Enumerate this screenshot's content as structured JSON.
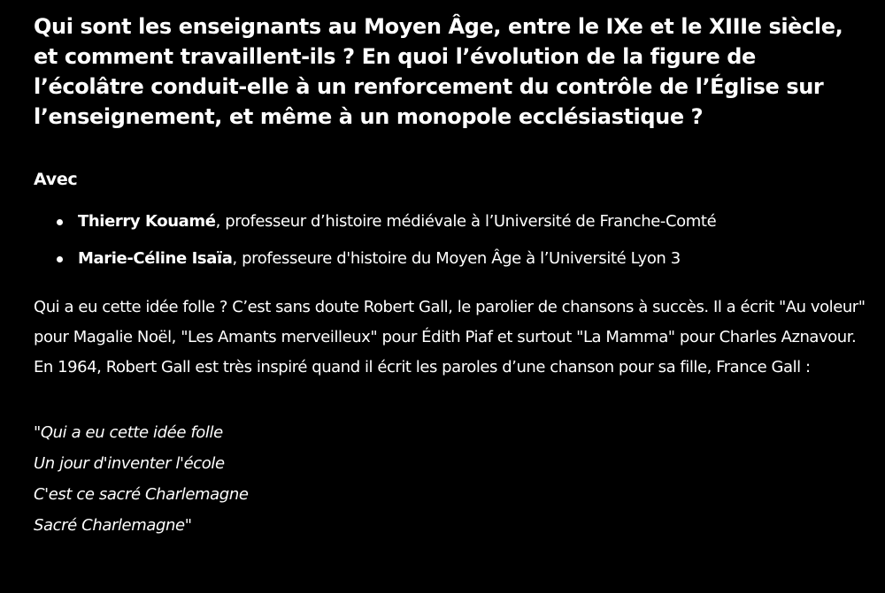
{
  "article": {
    "heading": "Qui sont les enseignants au Moyen Âge, entre le IXe et le XIIIe siècle, et comment travaillent-ils ? En quoi l’évolution de la figure de l’écolâtre conduit-elle à un renforcement du contrôle de l’Église sur l’enseignement, et même à un monopole ecclésiastique ?",
    "with_label": "Avec",
    "guests": [
      {
        "name": "Thierry Kouamé",
        "role": ", professeur d’histoire médiévale à l’Université de Franche-Comté"
      },
      {
        "name": "Marie-Céline Isaïa",
        "role": ", professeure d'histoire du Moyen Âge à l’Université Lyon 3"
      }
    ],
    "paragraph": "Qui a eu cette idée folle ? C’est sans doute Robert Gall, le parolier de chansons à succès. Il a écrit \"Au voleur\" pour Magalie Noël, \"Les Amants merveilleux\" pour Édith Piaf et surtout \"La Mamma\" pour Charles Aznavour. En 1964, Robert Gall est très inspiré quand il écrit les paroles d’une chanson pour sa fille, France Gall :",
    "quote_lines": [
      "\"Qui a eu cette idée folle",
      "Un jour d'inventer l'école",
      "C'est ce sacré Charlemagne",
      "Sacré Charlemagne\""
    ]
  },
  "colors": {
    "background": "#000000",
    "text": "#ffffff"
  }
}
